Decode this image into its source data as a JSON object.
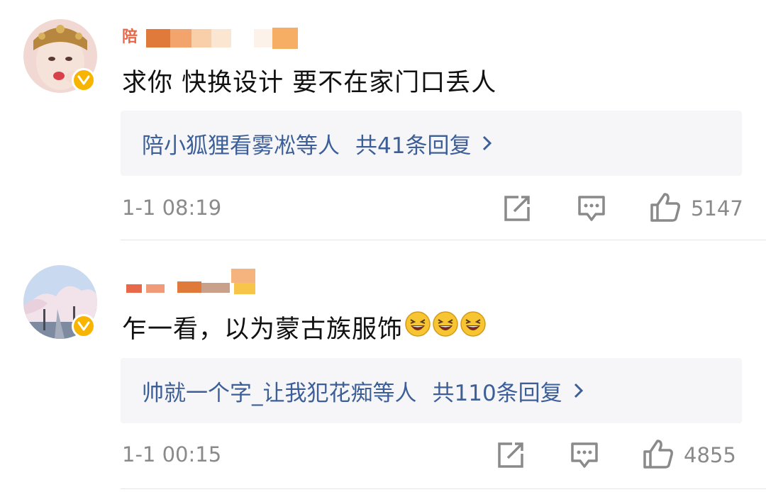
{
  "comments": [
    {
      "username_visible": "陪",
      "text": "求你 快换设计 要不在家门口丢人",
      "reply_users": "陪小狐狸看雾凇等人",
      "reply_count": "共41条回复",
      "time": "1-1 08:19",
      "likes": "5147"
    },
    {
      "text": "乍一看，以为蒙古族服饰",
      "emoji_names": [
        "laughing-emoji",
        "laughing-emoji",
        "laughing-emoji"
      ],
      "reply_users": "帅就一个字_让我犯花痴等人",
      "reply_count": "共110条回复",
      "time": "1-1 00:15",
      "likes": "4855"
    }
  ],
  "icons": {
    "repost": "repost-icon",
    "comment": "comment-icon",
    "like": "thumbs-up-icon",
    "verified": "verified-badge-icon",
    "chevron": "chevron-right-icon"
  },
  "colors": {
    "link": "#3d5f98",
    "meta": "#8a8a8a",
    "verified": "#f7b400",
    "reply_bg": "#f6f6f8"
  }
}
